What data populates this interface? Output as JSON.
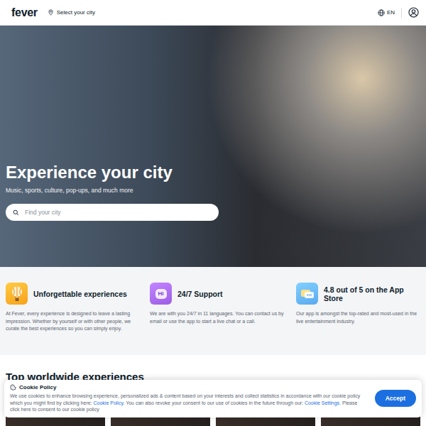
{
  "header": {
    "logo": "fever",
    "city_selector": "Select your city",
    "language": "EN"
  },
  "hero": {
    "title": "Experience your city",
    "subtitle": "Music, sports, culture, pop-ups, and much more",
    "search": {
      "placeholder": "Find your city"
    }
  },
  "features": [
    {
      "kind": "balloon",
      "color": "#f7a21b",
      "title": "Unforgettable experiences",
      "text": "At Fever, every experience is designed to leave a lasting impression. Whether by yourself or with other people, we curate the best experiences so you can simply enjoy."
    },
    {
      "kind": "chat",
      "color": "#9b5de5",
      "icon_text": "Hi",
      "title": "24/7 Support",
      "text": "We are with you 24/7 in 11 languages. You can contact us by email or use the app to start a live chat or a call."
    },
    {
      "kind": "app",
      "color": "#5aa9f0",
      "title": "4.8 out of 5 on the App Store",
      "text": "Our app is amongst the top-rated and most-used in the live entertainment industry."
    }
  ],
  "section": {
    "title": "Top worldwide experiences"
  },
  "cookie_banner": {
    "title": "Cookie Policy",
    "text": [
      {
        "text": "We use cookies to enhance browsing experience, personalized ads & content based on your interests and collect statistics in accordance with our cookie policy which you might find by clicking here: ",
        "link": false
      },
      {
        "text": "Cookie Policy",
        "link": true
      },
      {
        "text": ". You can also revoke your consent to our use of cookies in the future through our: ",
        "link": false
      },
      {
        "text": "Cookie Settings",
        "link": true
      },
      {
        "text": ". Please click here to consent to our cookie policy",
        "link": false
      }
    ],
    "accept": "Accept"
  }
}
